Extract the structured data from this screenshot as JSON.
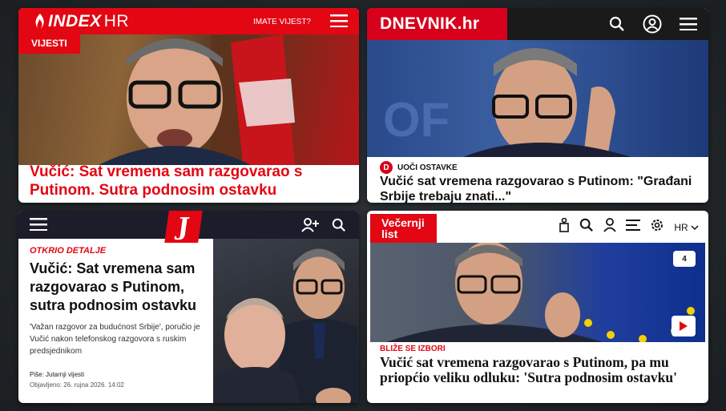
{
  "colors": {
    "index_red": "#e30613",
    "dnevnik_red": "#d6001c",
    "jutarnji_red": "#e30613",
    "vecernji_red": "#e30613"
  },
  "index": {
    "logo": "INDEX",
    "logo_suffix": "HR",
    "tip_link": "IMATE VIJEST?",
    "section": "VIJESTI",
    "headline": "Vučić: Sat vremena sam razgovarao s Putinom. Sutra podnosim ostavku"
  },
  "dnevnik": {
    "logo": "DNEVNIK.hr",
    "section_icon": "D",
    "section": "UOČI OSTAVKE",
    "headline": "Vučić sat vremena razgovarao s Putinom: \"Građani Srbije trebaju znati...\""
  },
  "jutarnji": {
    "logo": "J",
    "section": "OTKRIO DETALJE",
    "headline": "Vučić: Sat vremena sam razgovarao s Putinom, sutra podnosim ostavku",
    "lead": "'Važan razgovor za budućnost Srbije', poručio je Vučić nakon telefonskog razgovora s ruskim predsjednikom",
    "author": "Piše: Jutarnji vijesti",
    "date": "Objavljeno: 26. rujna 2026. 14:02"
  },
  "vecernji": {
    "logo_line1": "Večernji",
    "logo_line2": "list",
    "lang": "HR",
    "comment_count": "4",
    "section": "BLIŽE SE IZBORI",
    "headline": "Vučić sat vremena razgovarao s Putinom, pa mu priopćio veliku odluku: 'Sutra podnosim ostavku'"
  }
}
